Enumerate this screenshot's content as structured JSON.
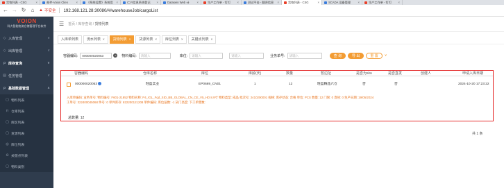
{
  "browser": {
    "tabs": [
      {
        "title": "货物列表 - CSG",
        "active": false
      },
      {
        "title": "邮件-Voion Clien",
        "active": false
      },
      {
        "title": "《系统设置》系统用",
        "active": false
      },
      {
        "title": "仁兴信息系统登记",
        "active": false
      },
      {
        "title": "Datasein Web 计",
        "active": false
      },
      {
        "title": "生产工作单 - 钉钉",
        "active": false
      },
      {
        "title": "测试平台 - 翻译信息",
        "active": false
      },
      {
        "title": "货物列表 - CSG",
        "active": true
      },
      {
        "title": "SCADA 设备管理",
        "active": false
      },
      {
        "title": "生产工作单 - 钉钉",
        "active": false
      }
    ],
    "security_label": "不安全",
    "url": "192.168.121.28:30080/#/warehouseJob/cargoList"
  },
  "sidebar": {
    "logo": "VOION",
    "subtitle": "科大智能物流仓储管理平台软件",
    "items": [
      {
        "label": "入库管理",
        "icon": "inbound-icon"
      },
      {
        "label": "出库管理",
        "icon": "outbound-icon"
      },
      {
        "label": "库存查询",
        "icon": "search-icon"
      },
      {
        "label": "任务管理",
        "icon": "task-icon"
      },
      {
        "label": "基础数据管理",
        "icon": "data-icon"
      }
    ],
    "subitems": [
      {
        "label": "物料列表"
      },
      {
        "label": "仓库列表"
      },
      {
        "label": "库区列表"
      },
      {
        "label": "货源列表"
      },
      {
        "label": "库位列表"
      },
      {
        "label": "关键点列表"
      },
      {
        "label": "物料类别"
      }
    ]
  },
  "header": {
    "breadcrumb_home": "首页",
    "breadcrumb_mid": "库存查询",
    "breadcrumb_current": "货物列表"
  },
  "tabs": [
    {
      "label": "入库单列表",
      "active": false
    },
    {
      "label": "流水列表",
      "active": false
    },
    {
      "label": "货物列表",
      "active": true
    },
    {
      "label": "货源列表",
      "active": false
    },
    {
      "label": "库位列表",
      "active": false
    },
    {
      "label": "关键点列表",
      "active": false
    }
  ],
  "filter": {
    "lot_label": "容器编码:",
    "lot_value": "000000020053",
    "material_label": "物料编码:",
    "material_placeholder": "请输入",
    "location_label": "库位:",
    "location_placeholder": "请输入",
    "third_placeholder": "请输入",
    "biz_label": "业务单号:",
    "biz_placeholder": "请输入",
    "search_btn": "查 询",
    "export_btn": "导 出",
    "reset_btn": "重 置",
    "expand": "∨"
  },
  "table": {
    "headers": [
      "容器编码",
      "仓库名称",
      "库位",
      "库龄(天)",
      "数量",
      "暂边址",
      "是否为sku",
      "是否直发",
      "创建人",
      "申请入库日期"
    ],
    "row": {
      "container": "000000020053",
      "warehouse": "旺盈实业",
      "location": "EP0669_CN01",
      "age": "1",
      "qty": "12",
      "addr": "旺盈精品六仓",
      "is_sku": "否",
      "is_direct": "否",
      "creator": "",
      "date": "2024-10-20 17:23:22"
    },
    "detail_line1": "入库单编码:   业务单号:   物料编号: F601-21852   物料名称: P4_IGL_Fqd_SID_BB_GLOBAL_CN_CE_V5_HD 8.9寸   物料类型: 成品   批次号: 2410200001   规格:   库存状态: 合格   单位: PCS   数量: 12   门限: 0   直径: 0   生产日期: 19/05/2024",
    "detail_line2": "工单号: 322400045068   件号: 0   单件库存: 822200121208   单件编码:   库位层数: -1   货门高度:   下工单需数:",
    "total": "总数量: 12"
  },
  "pager": "共 1 条"
}
